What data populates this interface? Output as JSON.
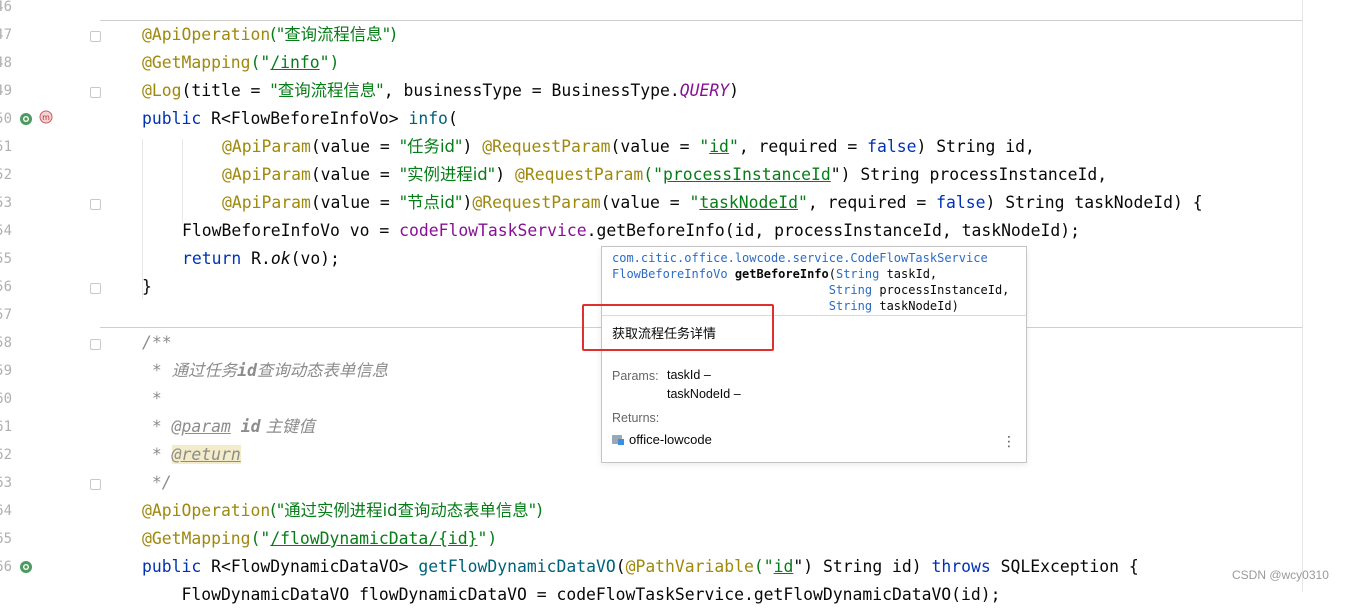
{
  "gutter": {
    "line_numbers": [
      "46",
      "47",
      "48",
      "49",
      "50",
      "51",
      "52",
      "53",
      "54",
      "55",
      "56",
      "57",
      "58",
      "59",
      "60",
      "61",
      "62",
      "63",
      "64",
      "65",
      "66"
    ]
  },
  "code": {
    "l1_ann": "@ApiOperation",
    "l1_str": "(\"查询流程信息\")",
    "l2_ann": "@GetMapping",
    "l2_p": "(\"",
    "l2_path": "/info",
    "l2_e": "\")",
    "l3_ann": "@Log",
    "l3_a": "(title = ",
    "l3_str": "\"查询流程信息\"",
    "l3_b": ", businessType = BusinessType.",
    "l3_q": "QUERY",
    "l3_c": ")",
    "l4_kw": "public",
    "l4_a": " R<FlowBeforeInfoVo> ",
    "l4_fn": "info",
    "l4_b": "(",
    "l5_ann": "@ApiParam",
    "l5_a": "(value = ",
    "l5_str": "\"任务id\"",
    "l5_b": ") ",
    "l5_ann2": "@RequestParam",
    "l5_c": "(value = ",
    "l5_q1": "\"",
    "l5_id": "id",
    "l5_q2": "\"",
    "l5_d": ", required = ",
    "l5_false": "false",
    "l5_e": ") String id,",
    "l6_ann": "@ApiParam",
    "l6_a": "(value = ",
    "l6_str": "\"实例进程id\"",
    "l6_b": ") ",
    "l6_ann2": "@RequestParam",
    "l6_c": "(\"",
    "l6_id": "processInstanceId",
    "l6_d": "\") String processInstanceId,",
    "l7_ann": "@ApiParam",
    "l7_a": "(value = ",
    "l7_str": "\"节点id\"",
    "l7_b": ")",
    "l7_ann2": "@RequestParam",
    "l7_c": "(value = ",
    "l7_q1": "\"",
    "l7_id": "taskNodeId",
    "l7_q2": "\"",
    "l7_d": ", required = ",
    "l7_false": "false",
    "l7_e": ") String taskNodeId) {",
    "l8_a": "FlowBeforeInfoVo vo = ",
    "l8_fld": "codeFlowTaskService",
    "l8_b": ".getBeforeInfo(id, processInstanceId, taskNodeId);",
    "l9_kw": "return",
    "l9_a": " R.",
    "l9_ok": "ok",
    "l9_b": "(vo);",
    "l10": "}",
    "l12": "/**",
    "l13_a": " * ",
    "l13_b": "通过任务",
    "l13_id": "id",
    "l13_c": "查询动态表单信息",
    "l14": " *",
    "l15_a": " * ",
    "l15_tag": "@param",
    "l15_b": " ",
    "l15_id": "id",
    "l15_c": " 主键值",
    "l16_a": " * ",
    "l16_tag": "@return",
    "l17": " */",
    "l18_ann": "@ApiOperation",
    "l18_str": "(\"通过实例进程id查询动态表单信息\")",
    "l19_ann": "@GetMapping",
    "l19_p": "(\"",
    "l19_path": "/flowDynamicData/{id}",
    "l19_e": "\")",
    "l20_kw": "public",
    "l20_a": " R<FlowDynamicDataVO> ",
    "l20_fn": "getFlowDynamicDataVO",
    "l20_b": "(",
    "l20_ann": "@PathVariable",
    "l20_c": "(\"",
    "l20_id": "id",
    "l20_d": "\") String id) ",
    "l20_kw2": "throws",
    "l20_e": " SQLException {",
    "l21": "    FlowDynamicDataVO flowDynamicDataVO = codeFlowTaskService.getFlowDynamicDataVO(id);"
  },
  "popup": {
    "package": "com.citic.office.lowcode.service.CodeFlowTaskService",
    "return_type": "FlowBeforeInfoVo",
    "method": "getBeforeInfo",
    "param1_type": "String",
    "param1": "taskId,",
    "param2_type": "String",
    "param2": "processInstanceId,",
    "param3_type": "String",
    "param3": "taskNodeId)",
    "description": "获取流程任务详情",
    "params_label": "Params:",
    "param_doc_1": "taskId –",
    "param_doc_2": "taskNodeId –",
    "returns_label": "Returns:",
    "module": "office-lowcode",
    "more_icon": "⋮"
  },
  "watermark": "CSDN @wcy0310",
  "colors": {
    "annotation": "#9e880d",
    "string": "#067d17",
    "keyword": "#0033b3",
    "highlight_box": "#e0302d"
  }
}
